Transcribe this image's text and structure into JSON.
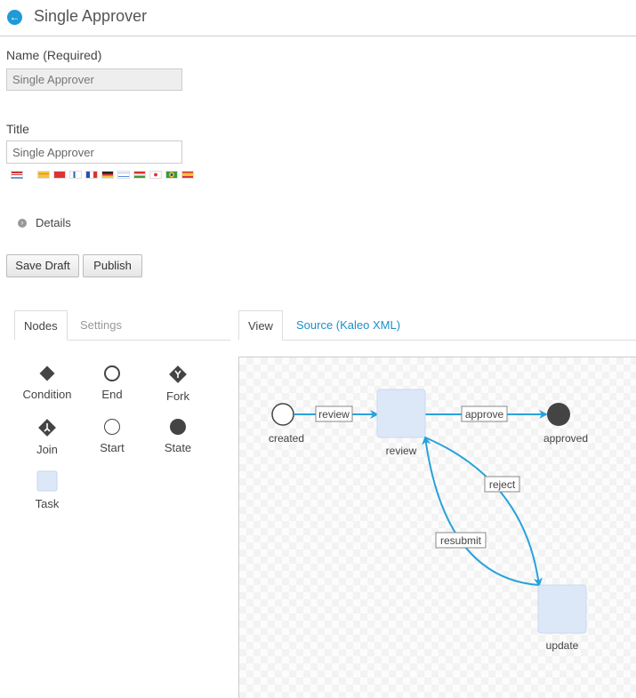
{
  "header": {
    "title": "Single Approver"
  },
  "form": {
    "name_label": "Name (Required)",
    "name_value": "Single Approver",
    "title_label": "Title",
    "title_value": "Single Approver",
    "details_label": "Details",
    "flags": [
      "en-US",
      "ca-ES",
      "zh-CN",
      "fi-FI",
      "fr-FR",
      "de-DE",
      "iw-IL",
      "hu-HU",
      "ja-JP",
      "pt-BR",
      "es-ES"
    ]
  },
  "actions": {
    "save_draft": "Save Draft",
    "publish": "Publish"
  },
  "left_tabs": {
    "nodes": "Nodes",
    "settings": "Settings"
  },
  "right_tabs": {
    "view": "View",
    "source": "Source (Kaleo XML)"
  },
  "palette": {
    "condition": "Condition",
    "end": "End",
    "fork": "Fork",
    "join": "Join",
    "start": "Start",
    "state": "State",
    "task": "Task"
  },
  "diagram": {
    "nodes": {
      "created": "created",
      "review": "review",
      "approved": "approved",
      "update": "update"
    },
    "edges": {
      "review": "review",
      "approve": "approve",
      "reject": "reject",
      "resubmit": "resubmit"
    }
  },
  "colors": {
    "accent": "#1e9bd7",
    "task_fill": "#dce8f7",
    "edge": "#27a2db"
  }
}
